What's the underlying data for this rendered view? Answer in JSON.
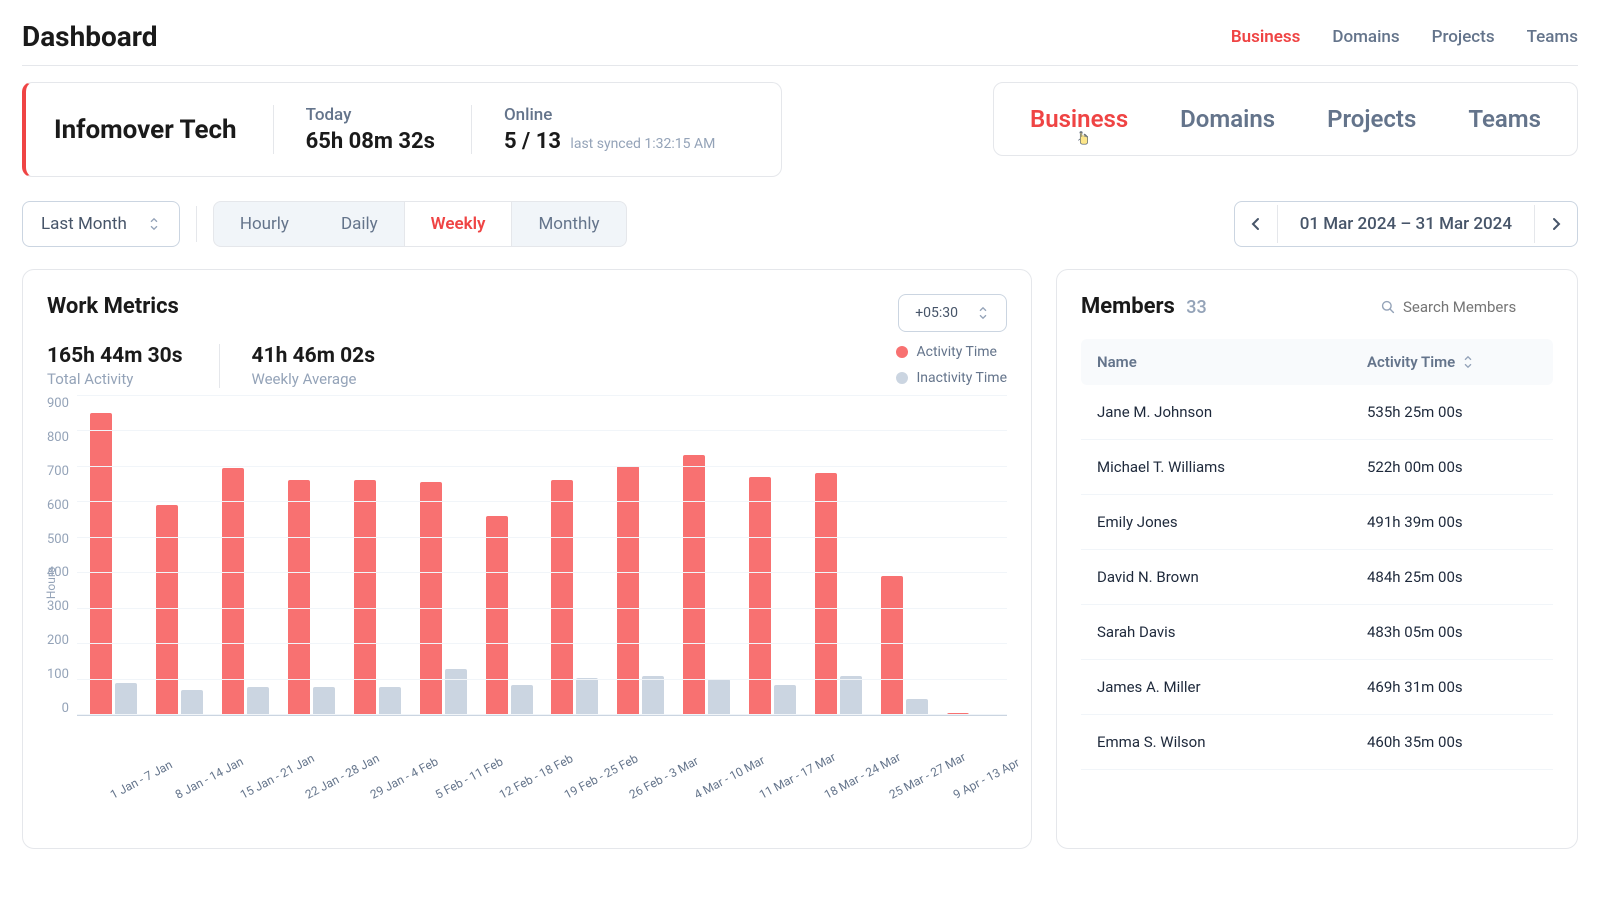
{
  "header": {
    "title": "Dashboard",
    "tabs": [
      "Business",
      "Domains",
      "Projects",
      "Teams"
    ]
  },
  "info": {
    "company": "Infomover Tech",
    "today_label": "Today",
    "today_value": "65h 08m 32s",
    "online_label": "Online",
    "online_value": "5 / 13",
    "synced": "last synced 1:32:15 AM"
  },
  "big_tabs": [
    "Business",
    "Domains",
    "Projects",
    "Teams"
  ],
  "period_select": "Last Month",
  "granularity": [
    "Hourly",
    "Daily",
    "Weekly",
    "Monthly"
  ],
  "granularity_active": "Weekly",
  "date_range": "01 Mar 2024 – 31 Mar 2024",
  "metrics": {
    "title": "Work Metrics",
    "tz": "+05:30",
    "total_label": "Total Activity",
    "total_value": "165h 44m 30s",
    "avg_label": "Weekly Average",
    "avg_value": "41h 46m 02s",
    "legend_activity": "Activity Time",
    "legend_inactivity": "Inactivity Time"
  },
  "members": {
    "title": "Members",
    "count": "33",
    "search_placeholder": "Search Members",
    "col_name": "Name",
    "col_time": "Activity Time",
    "rows": [
      {
        "name": "Jane M. Johnson",
        "time": "535h 25m 00s"
      },
      {
        "name": "Michael T. Williams",
        "time": "522h 00m 00s"
      },
      {
        "name": "Emily Jones",
        "time": "491h 39m 00s"
      },
      {
        "name": "David N. Brown",
        "time": "484h 25m 00s"
      },
      {
        "name": "Sarah Davis",
        "time": "483h 05m 00s"
      },
      {
        "name": "James A. Miller",
        "time": "469h 31m 00s"
      },
      {
        "name": "Emma S. Wilson",
        "time": "460h 35m 00s"
      }
    ]
  },
  "chart_data": {
    "type": "bar",
    "title": "Work Metrics",
    "ylabel": "Hours",
    "ylim": [
      0,
      900
    ],
    "y_ticks": [
      0,
      100,
      200,
      300,
      400,
      500,
      600,
      700,
      800,
      900
    ],
    "categories": [
      "1 Jan - 7 Jan",
      "8 Jan - 14 Jan",
      "15 Jan - 21 Jan",
      "22 Jan - 28 Jan",
      "29 Jan - 4 Feb",
      "5 Feb - 11 Feb",
      "12 Feb - 18 Feb",
      "19 Feb - 25 Feb",
      "26 Feb - 3 Mar",
      "4 Mar - 10 Mar",
      "11 Mar - 17 Mar",
      "18 Mar - 24 Mar",
      "25 Mar - 27 Mar",
      "9 Apr - 13 Apr"
    ],
    "series": [
      {
        "name": "Activity Time",
        "values": [
          850,
          590,
          695,
          660,
          660,
          655,
          560,
          660,
          700,
          730,
          670,
          680,
          390,
          5
        ]
      },
      {
        "name": "Inactivity Time",
        "values": [
          90,
          70,
          80,
          80,
          80,
          130,
          85,
          105,
          110,
          100,
          85,
          110,
          45,
          0
        ]
      }
    ]
  }
}
